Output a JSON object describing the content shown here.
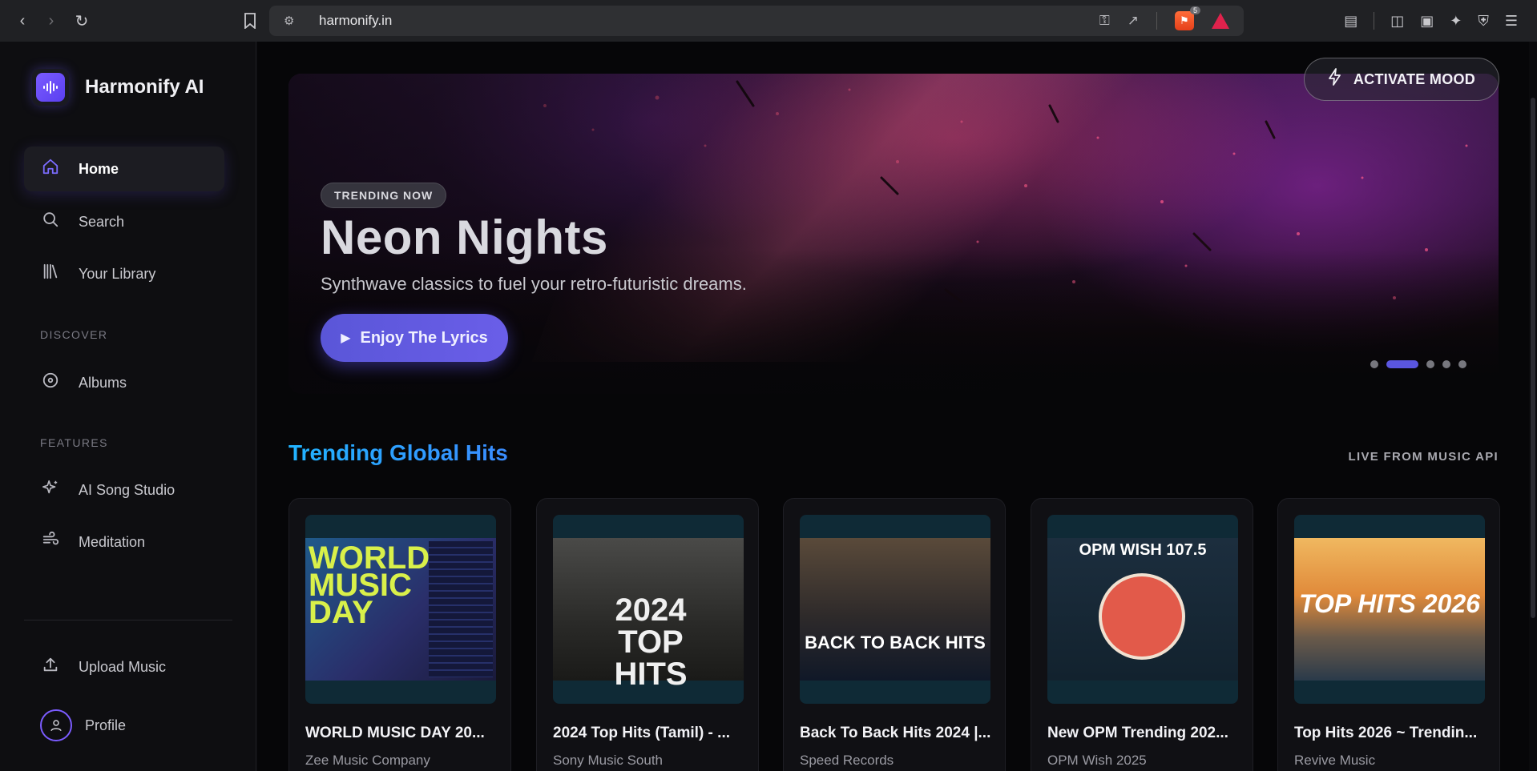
{
  "browser": {
    "url": "harmonify.in",
    "shields_count": "5"
  },
  "sidebar": {
    "brand": "Harmonify AI",
    "items": [
      {
        "label": "Home",
        "icon": "home-icon"
      },
      {
        "label": "Search",
        "icon": "search-icon"
      },
      {
        "label": "Your Library",
        "icon": "library-icon"
      }
    ],
    "discover_label": "DISCOVER",
    "discover_items": [
      {
        "label": "Albums",
        "icon": "disc-icon"
      }
    ],
    "features_label": "FEATURES",
    "features_items": [
      {
        "label": "AI Song Studio",
        "icon": "sparkles-icon"
      },
      {
        "label": "Meditation",
        "icon": "wind-icon"
      }
    ],
    "bottom_items": [
      {
        "label": "Upload Music",
        "icon": "upload-icon"
      },
      {
        "label": "Profile",
        "icon": "user-icon"
      }
    ]
  },
  "hero": {
    "badge": "TRENDING NOW",
    "title": "Neon Nights",
    "subtitle": "Synthwave classics to fuel your retro-futuristic dreams.",
    "cta_label": "Enjoy The Lyrics",
    "mood_label": "ACTIVATE MOOD",
    "slide_count": 5,
    "active_slide": 2
  },
  "trending": {
    "title": "Trending Global Hits",
    "tag": "LIVE FROM MUSIC API",
    "cards": [
      {
        "title": "WORLD MUSIC DAY 20...",
        "artist": "Zee Music Company",
        "thumb_text": "WORLD MUSIC DAY"
      },
      {
        "title": "2024 Top Hits (Tamil) - ...",
        "artist": "Sony Music South",
        "thumb_text": "2024 TOP HITS"
      },
      {
        "title": "Back To Back Hits 2024 |...",
        "artist": "Speed Records",
        "thumb_text": "BACK TO BACK HITS"
      },
      {
        "title": "New OPM Trending 202...",
        "artist": "OPM Wish 2025",
        "thumb_text": "OPM WISH 107.5"
      },
      {
        "title": "Top Hits 2026 ~ Trendin...",
        "artist": "Revive Music",
        "thumb_text": "TOP HITS 2026"
      }
    ]
  },
  "colors": {
    "accent": "#5a56e0",
    "brand": "#7b5cff",
    "title_gradient_start": "#21b3ff"
  }
}
